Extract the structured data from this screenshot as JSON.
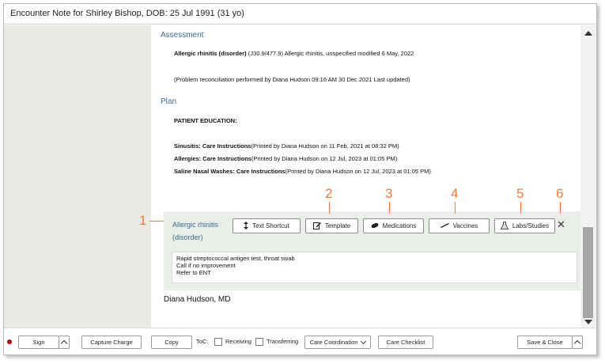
{
  "window": {
    "title": "Encounter Note for Shirley Bishop, DOB: 25 Jul 1991 (31 yo)"
  },
  "assessment": {
    "heading": "Assessment",
    "diagnosis_bold": "Allergic rhinitis (disorder)",
    "diagnosis_rest": " (J30.9/477.9) Allergic rhinitis, unspecified modified 6 May, 2022",
    "reconciliation": "(Problem reconciliation performed by Diana Hudson 09:16 AM 30 Dec 2021 Last updated)"
  },
  "plan": {
    "heading": "Plan",
    "education_title": "PATIENT EDUCATION:",
    "items": [
      {
        "bold": "Sinusitis: Care Instructions",
        "rest": "(Printed by Diana Hudson on 11 Feb, 2021 at 08:32 PM)"
      },
      {
        "bold": "Allergies: Care Instructions",
        "rest": "(Printed by Diana Hudson on 12 Jul, 2023 at 01:05 PM)"
      },
      {
        "bold": "Saline Nasal Washes: Care Instructions",
        "rest": "(Printed by Diana Hudson on 12 Jul, 2023 at 01:05 PM)"
      }
    ]
  },
  "plan_box": {
    "diagnosis_label": "Allergic rhinitis (disorder)",
    "buttons": {
      "text_shortcut": "Text Shortcut",
      "template": "Template",
      "medications": "Medications",
      "vaccines": "Vaccines",
      "labs_studies": "Labs/Studies"
    },
    "close": "✕",
    "plan_lines": [
      "Rapid streptococcal antigen test, throat swab",
      "Call if no improvement",
      "Refer to ENT"
    ]
  },
  "signer": "Diana Hudson, MD",
  "callouts": [
    "1",
    "2",
    "3",
    "4",
    "5",
    "6"
  ],
  "footer": {
    "sign": "Sign",
    "capture_charge": "Capture Charge",
    "copy": "Copy",
    "toc_label": "ToC:",
    "receiving": "Receiving",
    "transferring": "Transferring",
    "care_coordination": "Care Coordination",
    "care_checklist": "Care Checklist",
    "save_close": "Save & Close"
  },
  "colors": {
    "accent": "#3c6e8e",
    "callout": "#f07b3a",
    "status_dot": "#b20000"
  }
}
